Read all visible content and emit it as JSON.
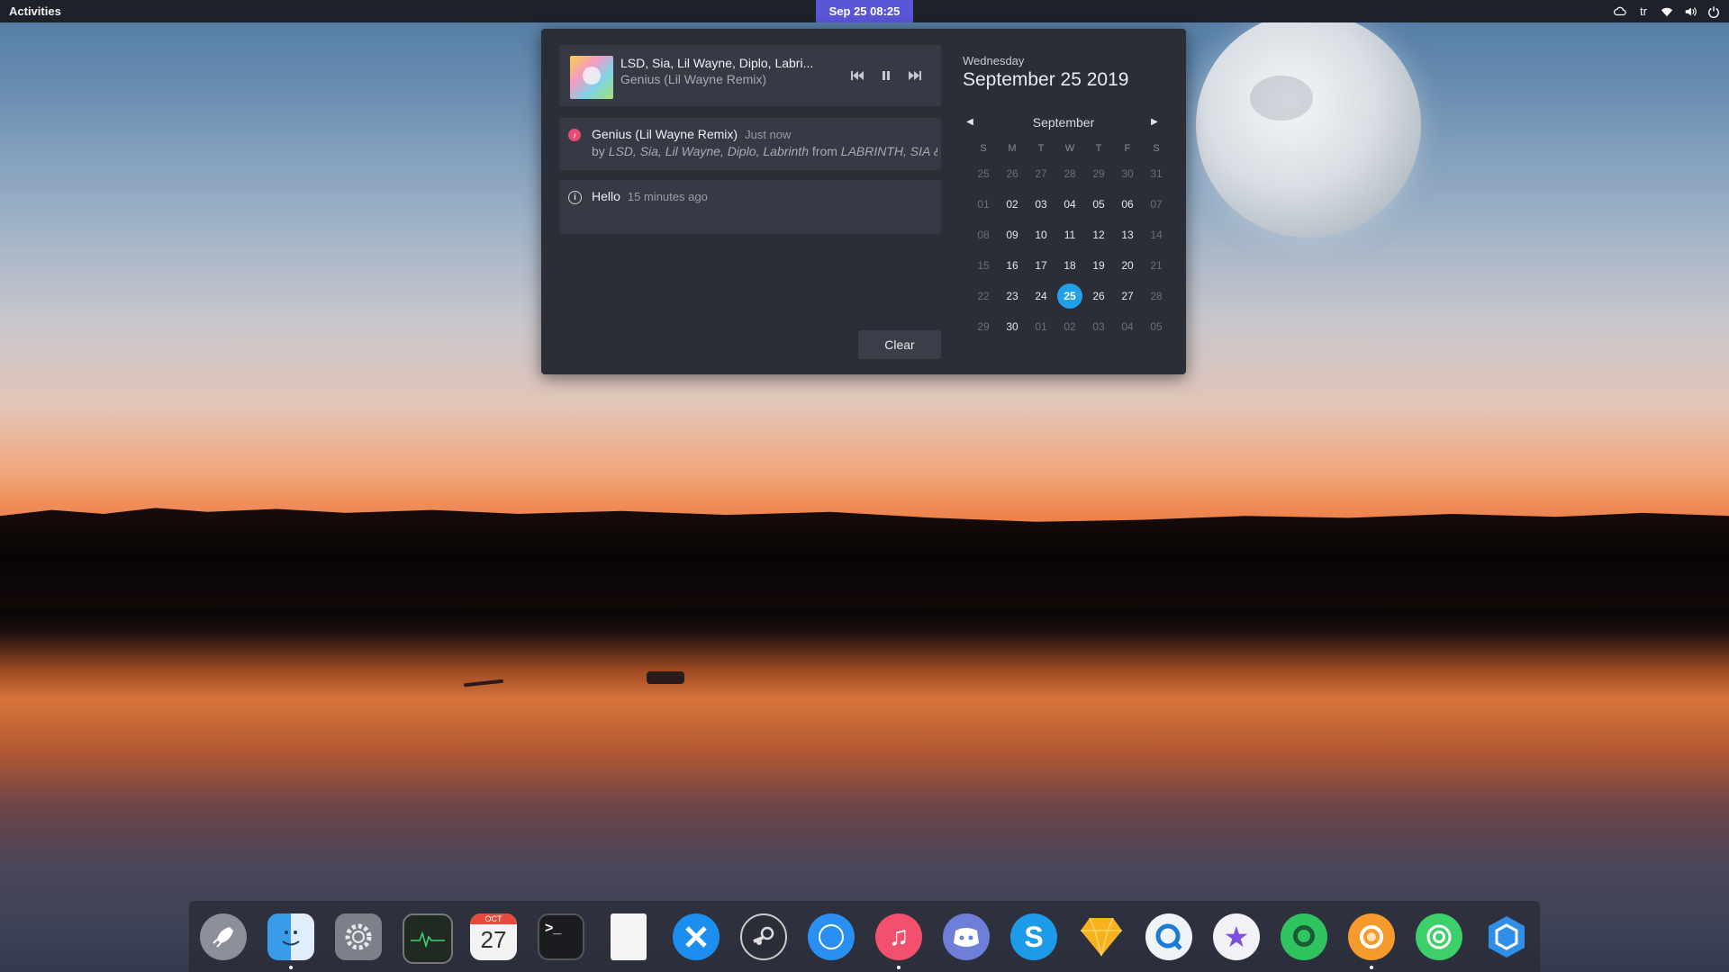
{
  "topbar": {
    "activities": "Activities",
    "clock": "Sep 25  08:25",
    "language": "tr"
  },
  "media": {
    "artist": "LSD, Sia, Lil Wayne, Diplo, Labri...",
    "title": "Genius (Lil Wayne Remix)"
  },
  "notification": {
    "title": "Genius (Lil Wayne Remix)",
    "time": "Just now",
    "body_prefix": "by ",
    "body_artists": "LSD, Sia, Lil Wayne, Diplo, Labrinth",
    "body_from": " from ",
    "body_album": "LABRINTH, SIA & ..."
  },
  "hello": {
    "title": "Hello",
    "time": "15 minutes ago"
  },
  "clear_label": "Clear",
  "calendar": {
    "weekday": "Wednesday",
    "date": "September 25 2019",
    "month": "September",
    "headers": [
      "S",
      "M",
      "T",
      "W",
      "T",
      "F",
      "S"
    ],
    "weeks": [
      [
        "25",
        "26",
        "27",
        "28",
        "29",
        "30",
        "31"
      ],
      [
        "01",
        "02",
        "03",
        "04",
        "05",
        "06",
        "07"
      ],
      [
        "08",
        "09",
        "10",
        "11",
        "12",
        "13",
        "14"
      ],
      [
        "15",
        "16",
        "17",
        "18",
        "19",
        "20",
        "21"
      ],
      [
        "22",
        "23",
        "24",
        "25",
        "26",
        "27",
        "28"
      ],
      [
        "29",
        "30",
        "01",
        "02",
        "03",
        "04",
        "05"
      ]
    ],
    "today": "25"
  },
  "dock": {
    "calendar_month": "OCT",
    "calendar_day": "27",
    "terminal_prompt": ">_",
    "items": [
      {
        "name": "launchpad",
        "color": "#8a8f98"
      },
      {
        "name": "finder",
        "color": "#3a9be8"
      },
      {
        "name": "system-preferences",
        "color": "#7d8088"
      },
      {
        "name": "activity-monitor",
        "color": "#1f2a22"
      },
      {
        "name": "calendar",
        "color": "#f3f3f3"
      },
      {
        "name": "terminal",
        "color": "#1b1c20"
      },
      {
        "name": "text-editor",
        "color": "#f4f4f4"
      },
      {
        "name": "xcode-tools",
        "color": "#1c8ef0"
      },
      {
        "name": "steam",
        "color": "#2b2e36"
      },
      {
        "name": "safari",
        "color": "#2a8ff2"
      },
      {
        "name": "music",
        "color": "#f2506d"
      },
      {
        "name": "discord",
        "color": "#6d7fd8"
      },
      {
        "name": "skype",
        "color": "#1e9be8"
      },
      {
        "name": "sketch",
        "color": "#f7b21e"
      },
      {
        "name": "quicktime",
        "color": "#f0f4f8"
      },
      {
        "name": "imovie-star",
        "color": "#f2f2f6"
      },
      {
        "name": "green-chat",
        "color": "#2fc460"
      },
      {
        "name": "orange-ring",
        "color": "#f59a2b"
      },
      {
        "name": "green-ring",
        "color": "#3ccf6a"
      },
      {
        "name": "blue-hex",
        "color": "#2f8ee8"
      }
    ]
  }
}
